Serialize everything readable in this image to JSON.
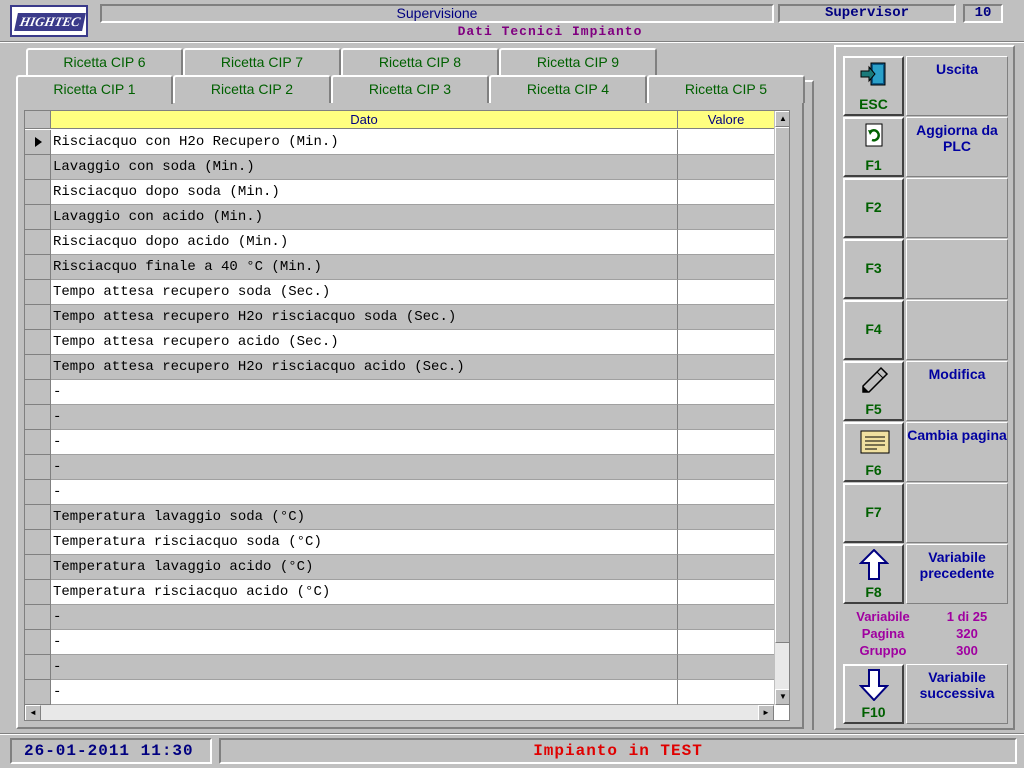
{
  "header": {
    "logo": "HIGHTEC",
    "title": "Supervisione",
    "subtitle": "Dati Tecnici Impianto",
    "user": "Supervisor",
    "level": "10"
  },
  "tabs_back": [
    "Ricetta CIP 6",
    "Ricetta CIP 7",
    "Ricetta CIP 8",
    "Ricetta CIP 9"
  ],
  "tabs_front": [
    "Ricetta CIP 1",
    "Ricetta CIP 2",
    "Ricetta CIP 3",
    "Ricetta CIP 4",
    "Ricetta CIP 5"
  ],
  "active_tab": "Ricetta CIP 1",
  "table": {
    "columns": [
      "Dato",
      "Valore"
    ],
    "rows": [
      {
        "dato": "Risciacquo con H2o Recupero (Min.)",
        "valore": ""
      },
      {
        "dato": "Lavaggio con soda (Min.)",
        "valore": ""
      },
      {
        "dato": "Risciacquo dopo soda (Min.)",
        "valore": ""
      },
      {
        "dato": "Lavaggio con acido (Min.)",
        "valore": ""
      },
      {
        "dato": "Risciacquo dopo acido (Min.)",
        "valore": ""
      },
      {
        "dato": "Risciacquo finale a 40 °C (Min.)",
        "valore": ""
      },
      {
        "dato": "Tempo attesa recupero soda (Sec.)",
        "valore": ""
      },
      {
        "dato": "Tempo attesa recupero H2o risciacquo soda (Sec.)",
        "valore": ""
      },
      {
        "dato": "Tempo attesa recupero acido (Sec.)",
        "valore": ""
      },
      {
        "dato": "Tempo attesa recupero H2o risciacquo acido (Sec.)",
        "valore": ""
      },
      {
        "dato": "-",
        "valore": ""
      },
      {
        "dato": "-",
        "valore": ""
      },
      {
        "dato": "-",
        "valore": ""
      },
      {
        "dato": "-",
        "valore": ""
      },
      {
        "dato": "-",
        "valore": ""
      },
      {
        "dato": "Temperatura lavaggio soda (°C)",
        "valore": ""
      },
      {
        "dato": "Temperatura risciacquo soda (°C)",
        "valore": ""
      },
      {
        "dato": "Temperatura lavaggio acido (°C)",
        "valore": ""
      },
      {
        "dato": "Temperatura risciacquo acido (°C)",
        "valore": ""
      },
      {
        "dato": "-",
        "valore": ""
      },
      {
        "dato": "-",
        "valore": ""
      },
      {
        "dato": "-",
        "valore": ""
      },
      {
        "dato": "-",
        "valore": ""
      }
    ]
  },
  "function_keys": [
    {
      "key": "ESC",
      "label": "Uscita",
      "icon": "exit-door-icon"
    },
    {
      "key": "F1",
      "label": "Aggiorna da PLC",
      "icon": "refresh-document-icon"
    },
    {
      "key": "F2",
      "label": ""
    },
    {
      "key": "F3",
      "label": ""
    },
    {
      "key": "F4",
      "label": ""
    },
    {
      "key": "F5",
      "label": "Modifica",
      "icon": "pencil-icon"
    },
    {
      "key": "F6",
      "label": "Cambia pagina",
      "icon": "page-icon"
    },
    {
      "key": "F7",
      "label": ""
    },
    {
      "key": "F8",
      "label": "Variabile precedente",
      "icon": "arrow-up-icon"
    },
    {
      "key": "F10",
      "label": "Variabile successiva",
      "icon": "arrow-down-icon"
    }
  ],
  "var_info": {
    "variabile_label": "Variabile",
    "variabile_value": "1 di 25",
    "pagina_label": "Pagina",
    "pagina_value": "320",
    "gruppo_label": "Gruppo",
    "gruppo_value": "300"
  },
  "status": {
    "datetime": "26-01-2011 11:30",
    "message": "Impianto in TEST"
  },
  "colors": {
    "background": "#c0c0c0",
    "header_yellow": "#ffff80",
    "key_green": "#006000",
    "label_blue": "#0000a0",
    "status_red": "#e00000",
    "info_magenta": "#a000a0"
  }
}
